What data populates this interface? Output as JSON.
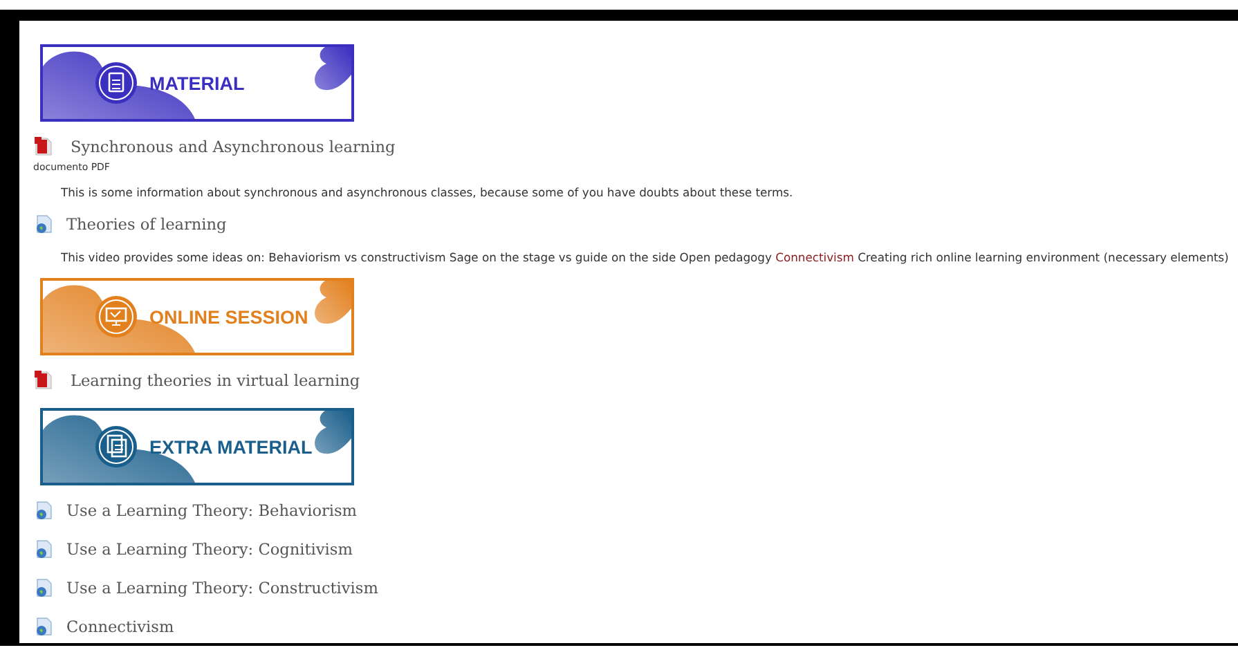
{
  "items": [
    {
      "kind": "banner",
      "label": "MATERIAL",
      "color": "#3b2fc0"
    },
    {
      "kind": "pdf",
      "title": "Synchronous and Asynchronous learning",
      "subtitle": "documento PDF",
      "description": {
        "text": "This is some information about synchronous and asynchronous classes, because some of you have doubts about these terms."
      }
    },
    {
      "kind": "web",
      "title": "Theories of learning",
      "description": {
        "text": "This video provides some ideas on: Behaviorism vs constructivism Sage on the stage vs guide on the side Open pedagogy",
        "link": "Connectivism",
        "after": "Creating rich online learning environment (necessary elements)"
      }
    },
    {
      "kind": "banner",
      "label": "ONLINE SESSION",
      "color": "#e2801e"
    },
    {
      "kind": "pdf",
      "title": "Learning theories in virtual learning"
    },
    {
      "kind": "banner",
      "label": "EXTRA MATERIAL",
      "color": "#1a5f8c"
    },
    {
      "kind": "web",
      "title": "Use a Learning Theory: Behaviorism"
    },
    {
      "kind": "web",
      "title": "Use a Learning Theory: Cognitivism"
    },
    {
      "kind": "web",
      "title": "Use a Learning Theory: Constructivism"
    },
    {
      "kind": "web",
      "title": "Connectivism"
    }
  ]
}
